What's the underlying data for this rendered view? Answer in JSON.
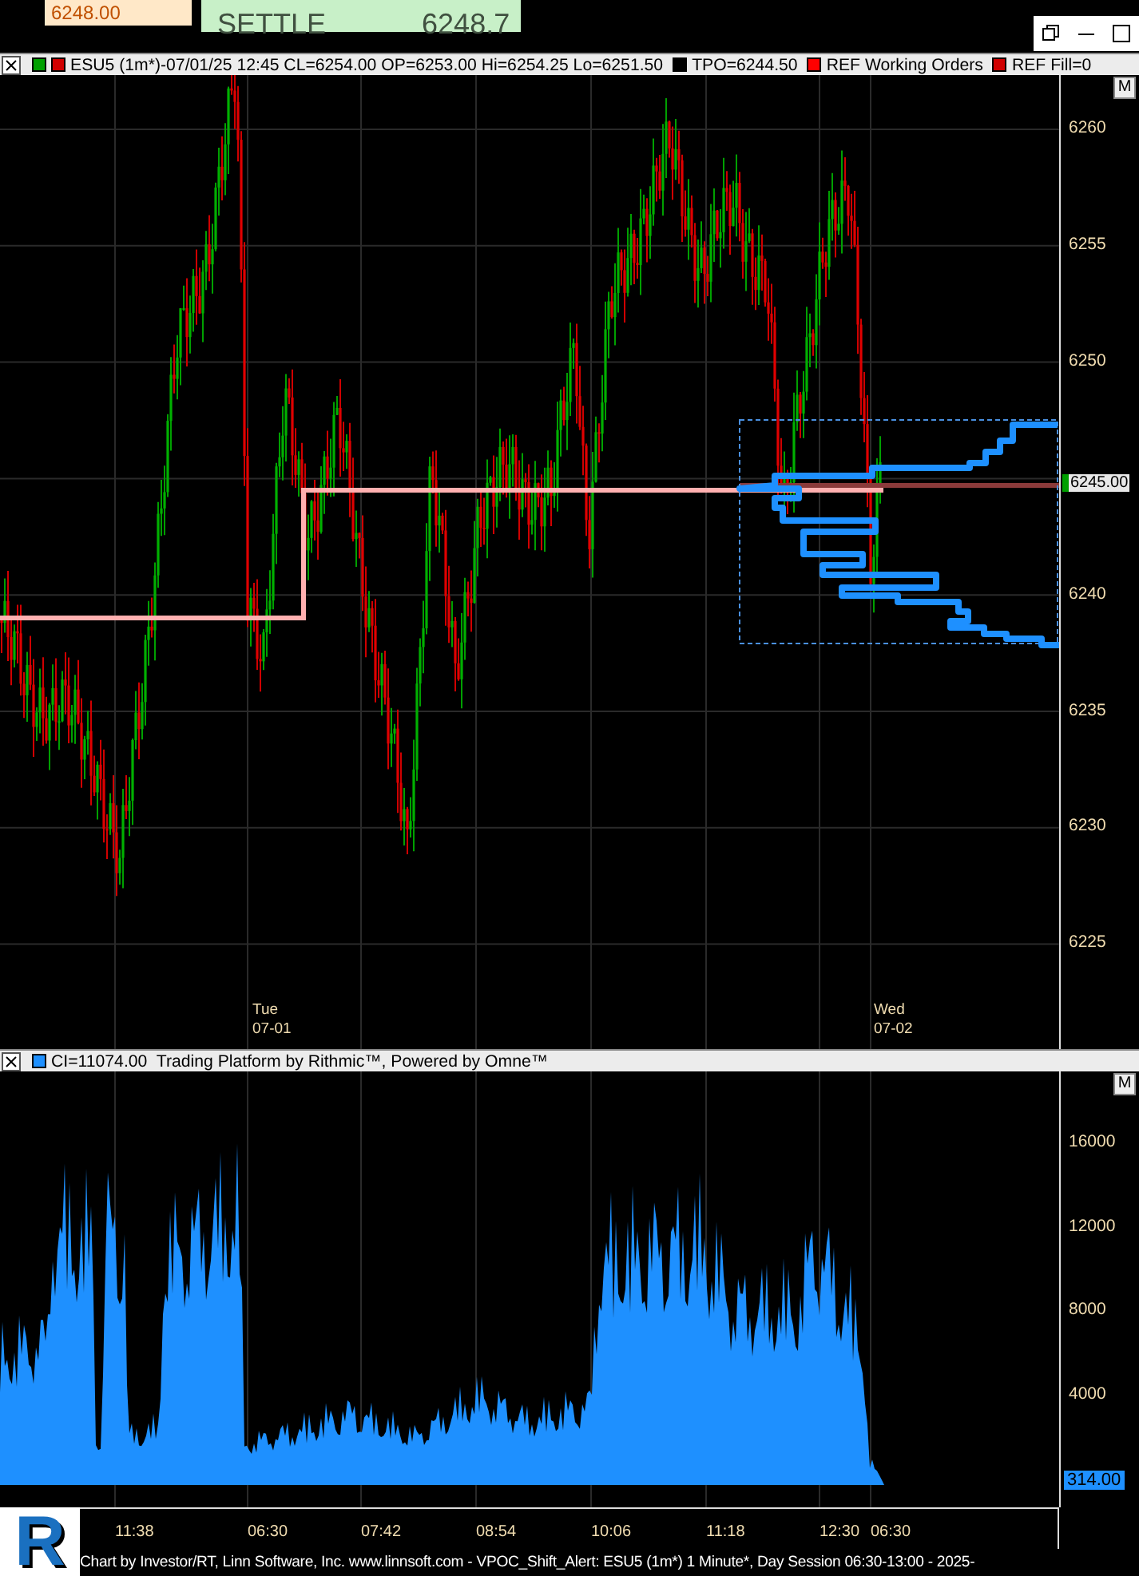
{
  "background_window": {
    "quote": "6248.00",
    "label": "SETTLE",
    "value": "6248.7"
  },
  "price_chart": {
    "legend": {
      "swatches": [
        {
          "color": "#00a000"
        },
        {
          "color": "#d00000"
        }
      ],
      "text": "ESU5 (1m*)-07/01/25 12:45 CL=6254.00 OP=6253.00 Hi=6254.25 Lo=6251.50",
      "items": [
        {
          "label": "TPO=6244.50",
          "color": "#000000"
        },
        {
          "label": "REF Working Orders",
          "color": "#ff0000"
        },
        {
          "label": "REF Fill=0",
          "color": "#d00000"
        }
      ]
    },
    "m_button": "M",
    "price_axis": [
      "6260",
      "6255",
      "6250",
      "6240",
      "6235",
      "6230",
      "6225"
    ],
    "last_price": "6245.00",
    "date_labels": [
      {
        "day": "Tue",
        "date": "07-01"
      },
      {
        "day": "Wed",
        "date": "07-02"
      }
    ]
  },
  "volume_chart": {
    "legend": {
      "color": "#1e90ff",
      "text": "CI=11074.00  Trading Platform by Rithmic™, Powered by Omne™"
    },
    "m_button": "M",
    "axis": [
      "16000",
      "12000",
      "8000",
      "4000"
    ],
    "last_value": "314.00"
  },
  "time_axis": [
    "11:38",
    "06:30",
    "07:42",
    "08:54",
    "10:06",
    "11:18",
    "12:30",
    "06:30"
  ],
  "logo_letter": "R",
  "footer": "Chart by Investor/RT, Linn Software, Inc. www.linnsoft.com - VPOC_Shift_Alert: ESU5 (1m*) 1 Minute*, Day Session 06:30-13:00 - 2025-"
}
